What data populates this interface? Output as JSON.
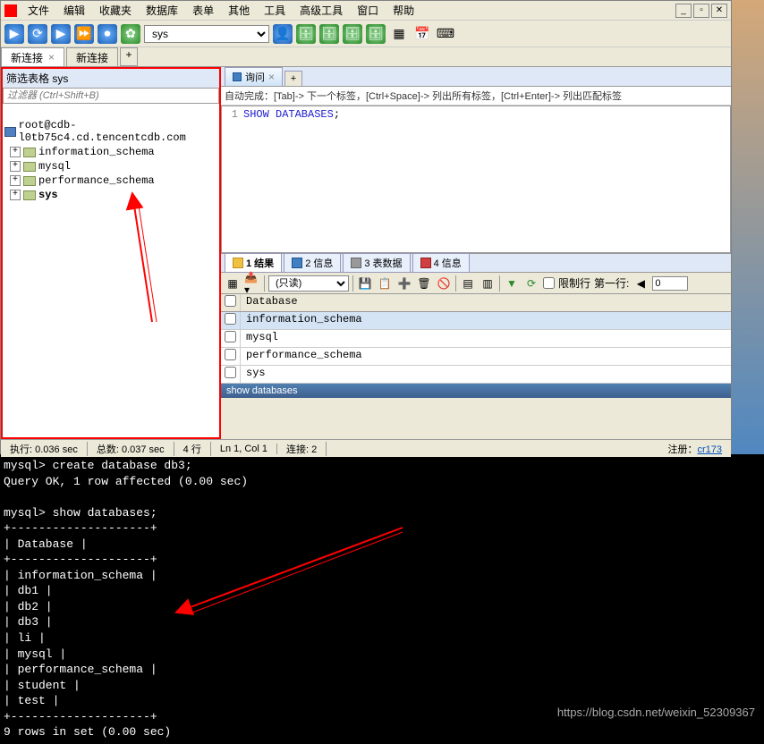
{
  "menu": {
    "items": [
      "文件",
      "编辑",
      "收藏夹",
      "数据库",
      "表单",
      "其他",
      "工具",
      "高级工具",
      "窗口",
      "帮助"
    ]
  },
  "toolbar": {
    "current_db": "sys"
  },
  "conn_tabs": {
    "tab1": "新连接",
    "tab2": "新连接"
  },
  "left": {
    "filter_header": "筛选表格 sys",
    "filter_placeholder": "过滤器 (Ctrl+Shift+B)",
    "root": "root@cdb-l0tb75c4.cd.tencentcdb.com",
    "dbs": [
      "information_schema",
      "mysql",
      "performance_schema",
      "sys"
    ],
    "bold_index": 3
  },
  "query": {
    "tab_label": "询问",
    "hint": "自动完成：[Tab]-> 下一个标签，[Ctrl+Space]-> 列出所有标签，[Ctrl+Enter]-> 列出匹配标签",
    "line_no": "1",
    "keyword": "SHOW DATABASES",
    "terminator": ";"
  },
  "result_tabs": {
    "t1": "1 结果",
    "t2": "2 信息",
    "t3": "3 表数据",
    "t4": "4 信息"
  },
  "result_toolbar": {
    "mode": "(只读)",
    "limit_label": "限制行",
    "first_label": "第一行:",
    "page": "0"
  },
  "grid": {
    "header": "Database",
    "rows": [
      "information_schema",
      "mysql",
      "performance_schema",
      "sys"
    ],
    "selected_index": 0
  },
  "status_msg": "show databases",
  "statusbar": {
    "exec": "执行: 0.036 sec",
    "total": "总数: 0.037 sec",
    "rows": "4 行",
    "pos": "Ln 1, Col 1",
    "conn": "连接: 2",
    "reg": "注册：",
    "reg_link": "cr173"
  },
  "terminal": {
    "lines": [
      "mysql>  create database db3;",
      "Query OK, 1 row affected (0.00 sec)",
      "",
      "mysql> show databases;",
      "+--------------------+",
      "| Database           |",
      "+--------------------+",
      "| information_schema |",
      "| db1                |",
      "| db2                |",
      "| db3                |",
      "| li                 |",
      "| mysql              |",
      "| performance_schema |",
      "| student            |",
      "| test               |",
      "+--------------------+",
      "9 rows in set (0.00 sec)"
    ]
  },
  "watermark": "https://blog.csdn.net/weixin_52309367"
}
